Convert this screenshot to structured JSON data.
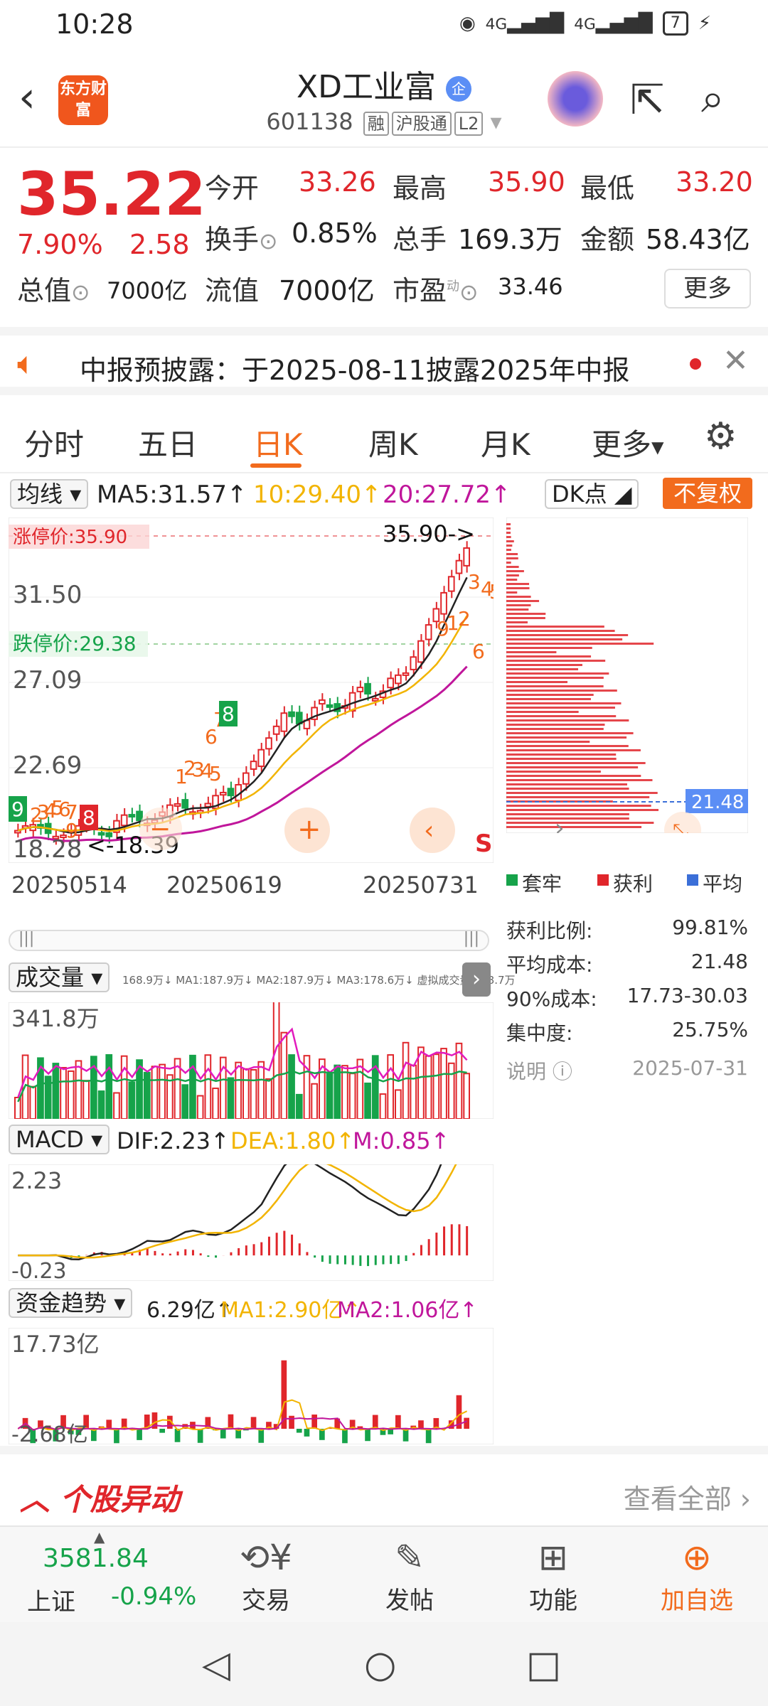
{
  "status": {
    "time": "10:28",
    "battery": "7",
    "signal1": "4G",
    "signal2": "4G"
  },
  "header": {
    "logo": "东方财富",
    "title": "XD工业富",
    "badge": "企",
    "code": "601138",
    "tags": [
      "融",
      "沪股通",
      "L2"
    ]
  },
  "quote": {
    "price": "35.22",
    "pct": "7.90%",
    "change": "2.58",
    "labels": {
      "open": "今开",
      "high": "最高",
      "low": "最低",
      "turnover": "换手",
      "volume": "总手",
      "amount": "金额",
      "mktcap": "总值",
      "float": "流值",
      "pe": "市盈"
    },
    "open": "33.26",
    "high": "35.90",
    "low": "33.20",
    "turnover": "0.85%",
    "volume": "169.3万",
    "amount": "58.43亿",
    "mktcap": "7000亿",
    "float": "7000亿",
    "pe": "33.46",
    "pe_sup": "动",
    "more": "更多"
  },
  "notice": {
    "text": "中报预披露：于2025-08-11披露2025年中报"
  },
  "tabs": [
    "分时",
    "五日",
    "日K",
    "周K",
    "月K",
    "更多"
  ],
  "active_tab": "日K",
  "ma": {
    "selector": "均线",
    "ma5": "MA5:31.57↑",
    "ma10": "10:29.40↑",
    "ma20": "20:27.72↑",
    "dk": "DK点",
    "nofq": "不复权"
  },
  "kline": {
    "limit_up": "涨停价:35.90",
    "limit_down": "跌停价:29.38",
    "high_mark": "35.90->",
    "low_mark": "<-18.39",
    "y_ticks": [
      "31.50",
      "27.09",
      "22.69",
      "18.28"
    ],
    "dates": [
      "20250514",
      "20250619",
      "20250731"
    ],
    "s_mark": "S",
    "seq_marks": [
      "9",
      "2",
      "3",
      "4",
      "5",
      "6",
      "7",
      "8",
      "9",
      "1",
      "2",
      "3",
      "4",
      "5",
      "6",
      "7",
      "8",
      "9",
      "1",
      "2",
      "3",
      "4",
      "5",
      "6"
    ]
  },
  "chip": {
    "avg_label": "21.48",
    "legend": [
      "套牢",
      "获利",
      "平均"
    ],
    "stats": [
      {
        "k": "获利比例:",
        "v": "99.81%"
      },
      {
        "k": "平均成本:",
        "v": "21.48"
      },
      {
        "k": "90%成本:",
        "v": "17.73-30.03"
      },
      {
        "k": "集中度:",
        "v": "25.75%"
      }
    ],
    "note": "说明",
    "date": "2025-07-31"
  },
  "volume": {
    "selector": "成交量",
    "legend": "168.9万↓ MA1:187.9万↓ MA2:187.9万↓ MA3:178.6万↓ 虚拟成交量:328.7万",
    "ytop": "341.8万"
  },
  "macd": {
    "selector": "MACD",
    "dif": "DIF:2.23↑",
    "dea": "DEA:1.80↑",
    "m": "M:0.85↑",
    "ytop": "2.23",
    "ybot": "-0.23"
  },
  "fund": {
    "selector": "资金趋势",
    "val": "6.29亿↑",
    "ma1": "MA1:2.90亿↑",
    "ma2": "MA2:1.06亿↑",
    "ytop": "17.73亿",
    "ybot": "-2.68亿"
  },
  "alert": {
    "title": "个股异动",
    "all": "查看全部"
  },
  "bottom": {
    "index_value": "3581.84",
    "index_name": "上证",
    "index_change": "-0.94%",
    "buttons": [
      "交易",
      "发帖",
      "功能",
      "加自选"
    ]
  },
  "colors": {
    "up": "#e0262b",
    "down": "#16a34a",
    "accent": "#f26b1d",
    "ma10": "#f2b400",
    "ma20": "#c0169b"
  }
}
